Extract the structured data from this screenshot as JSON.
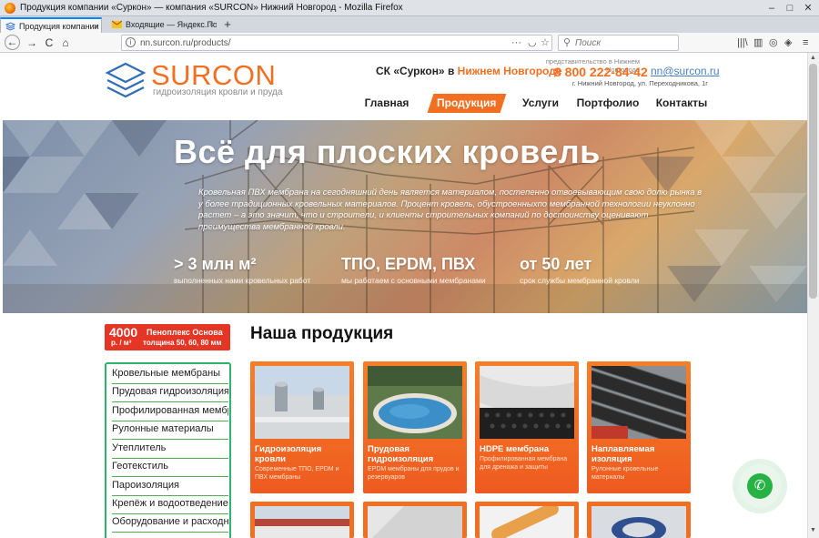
{
  "window": {
    "title": "Продукция компании «Суркон» — компания «SURCON» Нижний Новгород - Mozilla Firefox",
    "minimize": "–",
    "maximize": "□",
    "close": "✕"
  },
  "tabs": [
    {
      "label": "Продукция компании «Сурко",
      "close": "×"
    },
    {
      "label": "Входящие — Яндекс.Почта",
      "close": "×"
    }
  ],
  "new_tab": "+",
  "nav": {
    "url": "nn.surcon.ru/products/",
    "search_placeholder": "Поиск",
    "back": "←",
    "forward": "→",
    "reload": "C",
    "home": "⌂",
    "more": "···",
    "pocket": "◡",
    "star": "☆",
    "search_icon": "⚲",
    "library": "|||\\",
    "sidebar": "▥",
    "addon1": "◎",
    "addon2": "◈",
    "menu": "≡"
  },
  "site": {
    "brand": "SURCON",
    "brand_sub": "гидроизоляция кровли и пруда",
    "company_prefix": "СК «Суркон» в ",
    "company_city": "Нижнем Новгороде",
    "rep": "представительство в Нижнем Новгороде",
    "phone": "8 800 222-84-42",
    "email": "nn@surcon.ru",
    "address": "г. Нижний Новгород, ул. Переходникова, 1г",
    "menu": [
      "Главная",
      "Продукция",
      "Услуги",
      "Портфолио",
      "Контакты"
    ],
    "brand_color": "#f26f21"
  },
  "hero": {
    "title": "Всё для плоских кровель",
    "text": "Кровельная ПВХ мембрана на сегодняшний день является материалом, постепенно отвоевывающим свою долю рынка в у более традиционных кровельных материалов. Процент кровель, обустроенныхпо мембранной технологии неуклонно растет – а это значит, что и строители, и клиенты строительных компаний по достоинству оценивают преимущества мембранной кровли.",
    "stats": [
      {
        "big": "> 3 млн м²",
        "small": "выполненных нами кровельных работ"
      },
      {
        "big": "ТПО, EPDM, ПВХ",
        "small": "мы работаем с основными мембранами"
      },
      {
        "big": "от 50 лет",
        "small": "срок службы мембранной кровли"
      }
    ]
  },
  "promo": {
    "price": "4000",
    "unit": "р. / м³",
    "name": "Пеноплекс Основа",
    "thickness": "толщина 50, 60, 80 мм"
  },
  "section_title": "Наша продукция",
  "sidebar": [
    "Кровельные мембраны",
    "Прудовая гидроизоляция",
    "Профилированная мембрана",
    "Рулонные материалы",
    "Утеплитель",
    "Геотекстиль",
    "Пароизоляция",
    "Крепёж и водоотведение",
    "Оборудование и расходные"
  ],
  "products": [
    {
      "title": "Гидроизоляция кровли",
      "desc": "Современные ТПО, EPDM и ПВХ мембраны"
    },
    {
      "title": "Прудовая гидроизоляция",
      "desc": "EPDM мембраны для прудов и резервуаров"
    },
    {
      "title": "HDPE мембрана",
      "desc": "Профилированная мембрана для дренажа и защиты"
    },
    {
      "title": "Наплавляемая изоляция",
      "desc": "Рулонные кровельные материалы"
    }
  ],
  "whatsapp_icon": "✆"
}
